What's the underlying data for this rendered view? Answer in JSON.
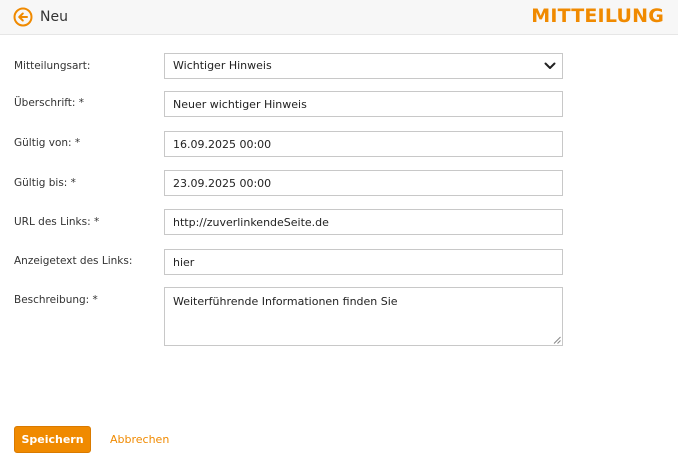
{
  "header": {
    "title": "Neu",
    "brand": "MITTEILUNG",
    "back_icon": "arrow-left-circle-icon",
    "accent_color": "#f08a00"
  },
  "form": {
    "message_type": {
      "label": "Mitteilungsart:",
      "value": "Wichtiger Hinweis"
    },
    "heading": {
      "label": "Überschrift: *",
      "value": "Neuer wichtiger Hinweis"
    },
    "valid_from": {
      "label": "Gültig von: *",
      "value": "16.09.2025 00:00"
    },
    "valid_to": {
      "label": "Gültig bis: *",
      "value": "23.09.2025 00:00"
    },
    "link_url": {
      "label": "URL des Links: *",
      "value": "http://zuverlinkendeSeite.de"
    },
    "link_text": {
      "label": "Anzeigetext des Links:",
      "value": "hier"
    },
    "description": {
      "label": "Beschreibung: *",
      "value": "Weiterführende Informationen finden Sie"
    }
  },
  "actions": {
    "save_label": "Speichern",
    "cancel_label": "Abbrechen"
  }
}
